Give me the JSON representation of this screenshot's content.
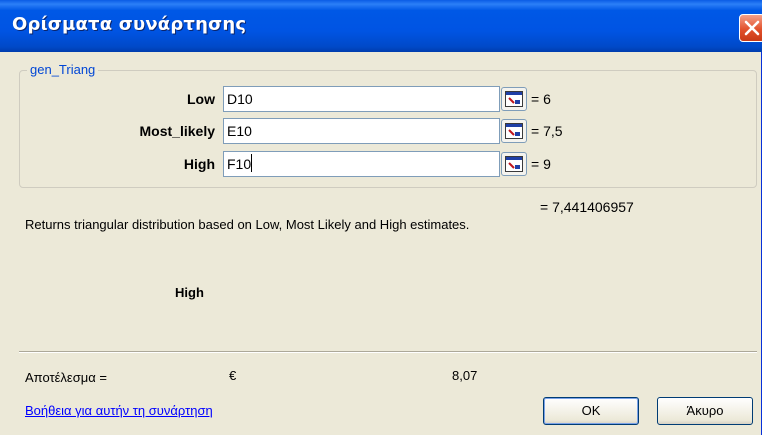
{
  "window": {
    "title": "Ορίσματα συνάρτησης",
    "close_icon": "close-icon"
  },
  "group": {
    "legend": "gen_Triang",
    "args": [
      {
        "label": "Low",
        "value": "D10",
        "result": "= 6"
      },
      {
        "label": "Most_likely",
        "value": "E10",
        "result": "= 7,5"
      },
      {
        "label": "High",
        "value": "F10",
        "result": "= 9"
      }
    ],
    "collapse_icon": "collapse-dialog-icon"
  },
  "formula_result": "= 7,441406957",
  "description": "Returns triangular distribution based on Low, Most Likely and High estimates.",
  "current_arg_name": "High",
  "result_row": {
    "label": "Αποτέλεσμα =",
    "currency": "€",
    "value": "8,07"
  },
  "footer": {
    "help_link": "Βοήθεια για αυτήν τη συνάρτηση",
    "ok_label": "OK",
    "cancel_label": "Άκυρο"
  },
  "colors": {
    "titlebar": "#0054e3",
    "dialog_bg": "#ece9d8",
    "legend_text": "#0046d5",
    "link": "#0000ff",
    "close_button": "#e2512c"
  }
}
